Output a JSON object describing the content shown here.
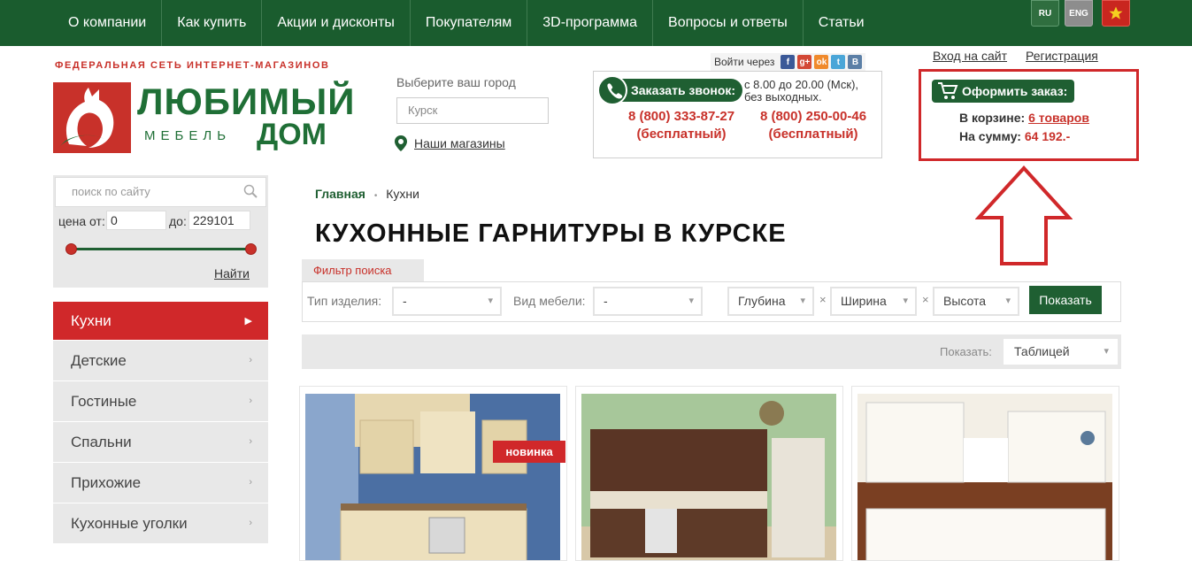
{
  "topnav": {
    "items": [
      "О компании",
      "Как купить",
      "Акции и дисконты",
      "Покупателям",
      "3D-программа",
      "Вопросы и ответы",
      "Статьи"
    ],
    "languages": [
      "RU",
      "ENG"
    ]
  },
  "logo": {
    "tagline": "ФЕДЕРАЛЬНАЯ СЕТЬ ИНТЕРНЕТ-МАГАЗИНОВ",
    "word1": "ЛЮБИМЫЙ",
    "word_sub": "МЕБЕЛЬ",
    "word2": "ДОМ"
  },
  "city": {
    "label": "Выберите ваш город",
    "value": "Курск",
    "stores_link": "Наши магазины"
  },
  "social": {
    "label": "Войти через",
    "icons": [
      "f",
      "g+",
      "ok",
      "t",
      "B"
    ]
  },
  "phones": {
    "callback_label": "Заказать звонок:",
    "hours_line1": "с 8.00 до 20.00 (Мск),",
    "hours_line2": "без выходных.",
    "phone1": "8 (800) 333-87-27",
    "phone2": "8 (800) 250-00-46",
    "free_note": "(бесплатный)"
  },
  "auth": {
    "login": "Вход на сайт",
    "register": "Регистрация"
  },
  "cart": {
    "button_label": "Оформить заказ:",
    "in_cart_label": "В корзине:",
    "in_cart_value": "6 товаров",
    "sum_label": "На сумму:",
    "sum_value": "64 192.-"
  },
  "search": {
    "placeholder": "поиск по сайту",
    "price_from_label": "цена от:",
    "price_from_value": "0",
    "price_to_label": "до:",
    "price_to_value": "229101",
    "find_label": "Найти"
  },
  "categories": [
    {
      "label": "Кухни",
      "active": true
    },
    {
      "label": "Детские",
      "active": false
    },
    {
      "label": "Гостиные",
      "active": false
    },
    {
      "label": "Спальни",
      "active": false
    },
    {
      "label": "Прихожие",
      "active": false
    },
    {
      "label": "Кухонные уголки",
      "active": false
    }
  ],
  "breadcrumb": {
    "home": "Главная",
    "current": "Кухни"
  },
  "page_title": "КУХОННЫЕ ГАРНИТУРЫ В КУРСКЕ",
  "filter": {
    "tab_label": "Фильтр поиска",
    "type_label": "Тип изделия:",
    "type_value": "-",
    "kind_label": "Вид мебели:",
    "kind_value": "-",
    "depth": "Глубина",
    "width": "Ширина",
    "height": "Высота",
    "times": "×",
    "show_button": "Показать"
  },
  "view": {
    "label": "Показать:",
    "value": "Таблицей"
  },
  "products": {
    "badge_new": "новинка"
  },
  "colors": {
    "brand_green": "#1a5c2e",
    "brand_red": "#c8312a",
    "highlight_red": "#d0282a"
  }
}
